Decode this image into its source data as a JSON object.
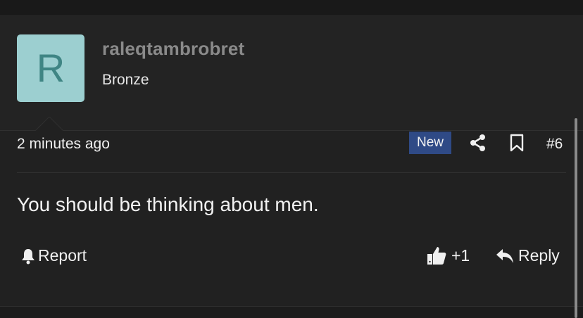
{
  "post": {
    "author": {
      "avatar_letter": "R",
      "username": "raleqtambrobret",
      "rank": "Bronze",
      "avatar_color": "#9ccfd0"
    },
    "time_ago": "2 minutes ago",
    "badge": "New",
    "badge_color": "#2f4a86",
    "post_number": "#6",
    "content": "You should be thinking about men.",
    "actions": {
      "report_label": "Report",
      "like_count": "+1",
      "reply_label": "Reply"
    }
  },
  "icons": {
    "share": "share-icon",
    "bookmark": "bookmark-icon",
    "report": "bell-icon",
    "like": "thumbs-up-icon",
    "reply": "reply-arrow-icon"
  }
}
